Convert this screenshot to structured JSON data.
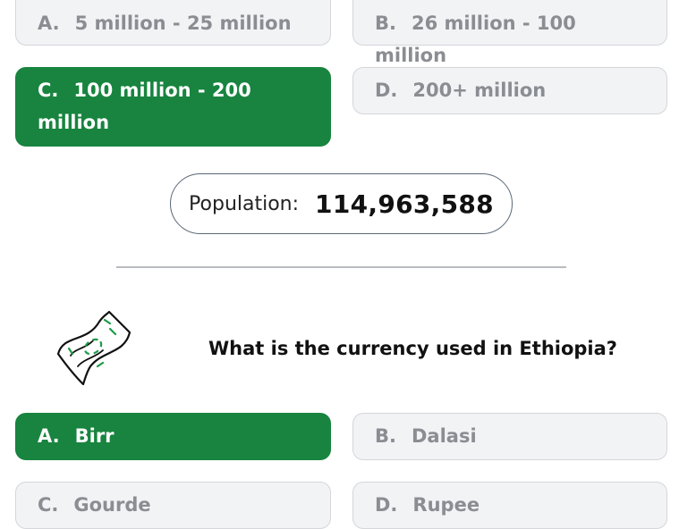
{
  "question1": {
    "options": [
      {
        "letter": "A.",
        "text": "5 million - 25 million",
        "selected": false
      },
      {
        "letter": "B.",
        "text": "26 million - 100 million",
        "selected": false
      },
      {
        "letter": "C.",
        "text": "100 million - 200 million",
        "selected": true
      },
      {
        "letter": "D.",
        "text": "200+ million",
        "selected": false
      }
    ]
  },
  "population": {
    "label": "Population:",
    "value": "114,963,588"
  },
  "question2": {
    "icon": "money-icon",
    "text": "What is the currency used in Ethiopia?",
    "options": [
      {
        "letter": "A.",
        "text": "Birr",
        "selected": true
      },
      {
        "letter": "B.",
        "text": "Dalasi",
        "selected": false
      },
      {
        "letter": "C.",
        "text": "Gourde",
        "selected": false
      },
      {
        "letter": "D.",
        "text": "Rupee",
        "selected": false
      }
    ]
  },
  "colors": {
    "selected": "#18843f",
    "option_bg": "#f2f3f5",
    "option_text": "#8a8d92"
  }
}
